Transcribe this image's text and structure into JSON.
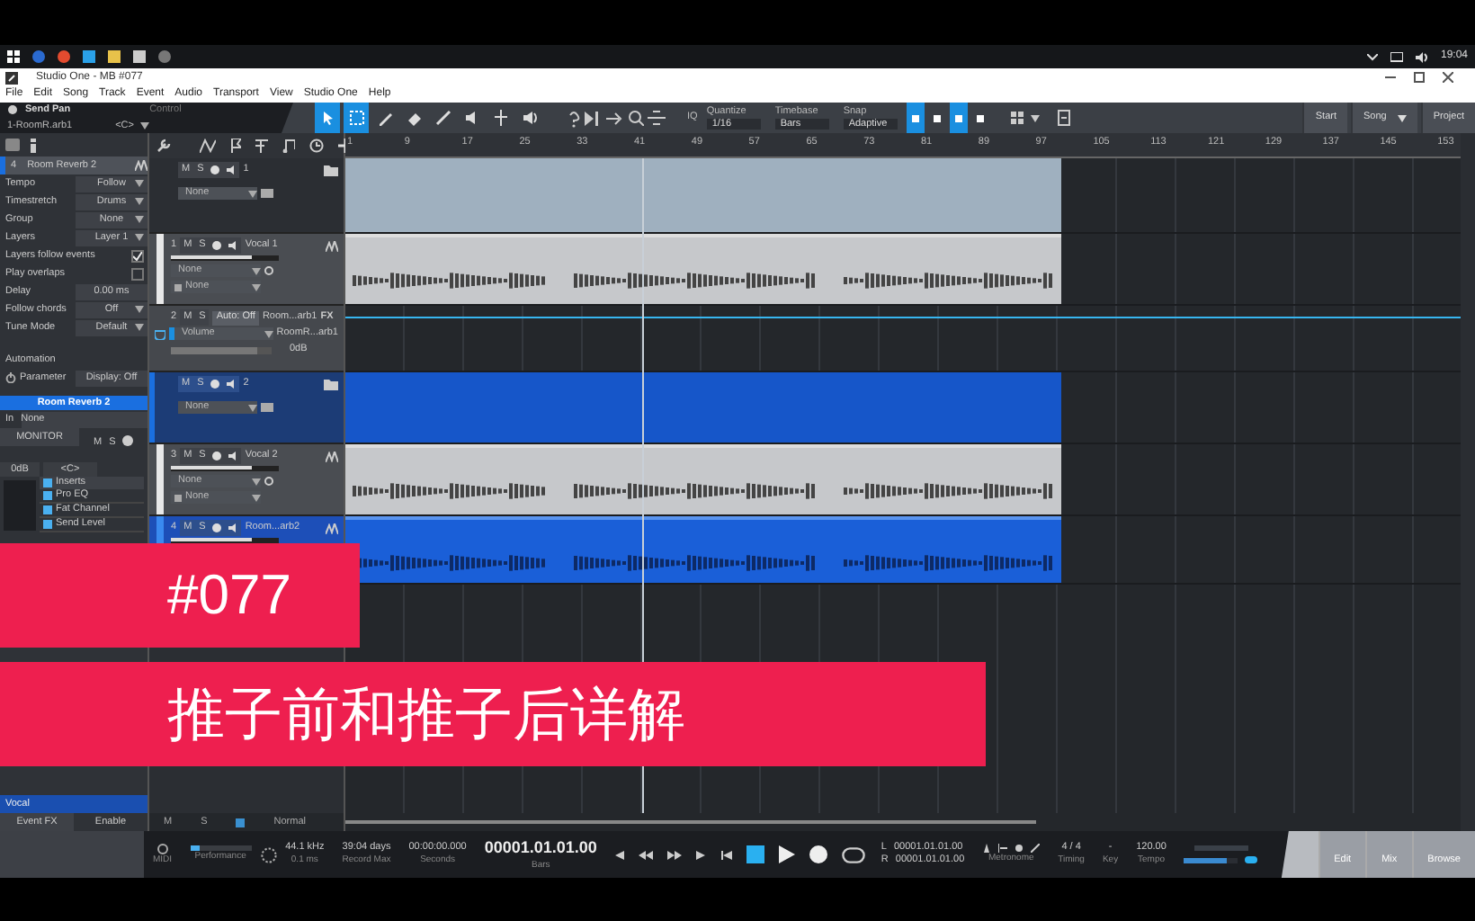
{
  "taskbar": {
    "time": "19:04"
  },
  "window": {
    "title": "Studio One - MB #077"
  },
  "menu": [
    "File",
    "Edit",
    "Song",
    "Track",
    "Event",
    "Audio",
    "Transport",
    "View",
    "Studio One",
    "Help"
  ],
  "toolbar": {
    "send_label": "Send Pan",
    "send_target": "1-RoomR.arb1",
    "send_value": "<C>",
    "control_label": "Control",
    "tools": [
      {
        "kind": "arrow",
        "selected": true
      },
      {
        "kind": "range",
        "selected": true
      },
      {
        "kind": "pencil",
        "selected": false
      },
      {
        "kind": "eraser",
        "selected": false
      },
      {
        "kind": "paint",
        "selected": false
      },
      {
        "kind": "mute",
        "selected": false
      },
      {
        "kind": "split",
        "selected": false
      },
      {
        "kind": "listen",
        "selected": false
      }
    ],
    "iq": "IQ",
    "quantize": {
      "label": "Quantize",
      "value": "1/16"
    },
    "timebase": {
      "label": "Timebase",
      "value": "Bars"
    },
    "snap": {
      "label": "Snap",
      "value": "Adaptive"
    },
    "snap_buttons": [
      {
        "on": true
      },
      {
        "on": false
      },
      {
        "on": true
      },
      {
        "on": false
      }
    ],
    "pages": [
      {
        "label": "Start"
      },
      {
        "label": "Song"
      },
      {
        "label": "Project"
      }
    ]
  },
  "inspector": {
    "track_number": "4",
    "track_name": "Room Reverb 2",
    "fields": [
      {
        "kind": "dropdown",
        "label": "Tempo",
        "value": "Follow"
      },
      {
        "kind": "dropdown",
        "label": "Timestretch",
        "value": "Drums"
      },
      {
        "kind": "dropdown",
        "label": "Group",
        "value": "None"
      },
      {
        "kind": "dropdown",
        "label": "Layers",
        "value": "Layer 1"
      },
      {
        "kind": "checkbox",
        "label": "Layers follow events",
        "checked": true
      },
      {
        "kind": "checkbox",
        "label": "Play overlaps",
        "checked": false
      },
      {
        "kind": "number",
        "label": "Delay",
        "value": "0.00 ms"
      },
      {
        "kind": "dropdown",
        "label": "Follow chords",
        "value": "Off"
      },
      {
        "kind": "dropdown",
        "label": "Tune Mode",
        "value": "Default"
      }
    ],
    "automation_label": "Automation",
    "parameter_label": "Parameter",
    "parameter_value": "Display: Off",
    "channel": {
      "name": "Room Reverb 2",
      "input_label": "In",
      "input": "None",
      "monitor": "MONITOR",
      "mute": "M",
      "solo": "S",
      "volume": "0dB",
      "pan": "<C>",
      "inserts_label": "Inserts",
      "inserts": [
        "Pro EQ",
        "Fat Channel",
        "Send Level"
      ]
    },
    "footer": {
      "name": "Vocal",
      "event_fx": "Event FX",
      "enable": "Enable"
    }
  },
  "ruler": [
    "1",
    "9",
    "17",
    "25",
    "33",
    "41",
    "49",
    "57",
    "65",
    "73",
    "81",
    "89",
    "97",
    "105",
    "113",
    "121",
    "129",
    "137",
    "145",
    "153"
  ],
  "tracks": [
    {
      "kind": "folder",
      "number": "1",
      "mute": "M",
      "solo": "S",
      "selected": false,
      "dropdown": "None"
    },
    {
      "kind": "audio",
      "number": "1",
      "mute": "M",
      "solo": "S",
      "name": "Vocal 1",
      "selected": false,
      "input": "None",
      "output": "None"
    },
    {
      "kind": "automation",
      "number": "2",
      "mute": "M",
      "solo": "S",
      "mode": "Auto: Off",
      "name": "Room...arb1",
      "fx": "FX",
      "parameter": "Volume",
      "target": "RoomR...arb1",
      "value": "0dB",
      "level": 0.85
    },
    {
      "kind": "folder",
      "number": "2",
      "mute": "M",
      "solo": "S",
      "selected": true,
      "dropdown": "None"
    },
    {
      "kind": "audio",
      "number": "3",
      "mute": "M",
      "solo": "S",
      "name": "Vocal 2",
      "selected": false,
      "input": "None",
      "output": "None"
    },
    {
      "kind": "audio",
      "number": "4",
      "mute": "M",
      "solo": "S",
      "name": "Room...arb2",
      "selected": true
    }
  ],
  "track_footer": {
    "mute": "M",
    "solo": "S",
    "mode": "Normal"
  },
  "transport": {
    "midi": "MIDI",
    "performance": {
      "label": "Performance",
      "level": 0.15
    },
    "sample_rate": "44.1 kHz",
    "latency": "0.1 ms",
    "record_max": "39:04 days",
    "record_max_label": "Record Max",
    "seconds": "00:00:00.000",
    "seconds_label": "Seconds",
    "bars": "00001.01.01.00",
    "bars_label": "Bars",
    "locators": [
      {
        "label": "L",
        "value": "00001.01.01.00"
      },
      {
        "label": "R",
        "value": "00001.01.01.00"
      }
    ],
    "metronome_label": "Metronome",
    "timing": "4 / 4",
    "timing_label": "Timing",
    "key": "-",
    "key_label": "Key",
    "tempo": "120.00",
    "tempo_label": "Tempo",
    "volume": {
      "level": 0.8
    },
    "views": [
      {
        "label": "Edit"
      },
      {
        "label": "Mix"
      },
      {
        "label": "Browse"
      }
    ]
  },
  "overlay": {
    "episode": "#077",
    "title": "推子前和推子后详解"
  }
}
